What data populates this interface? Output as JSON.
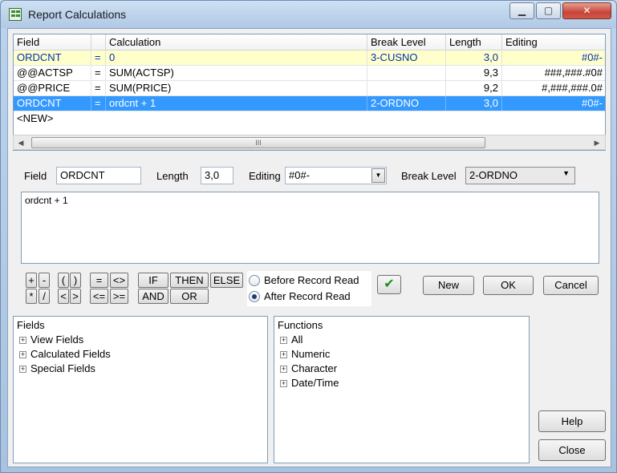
{
  "window": {
    "title": "Report Calculations"
  },
  "grid": {
    "headers": [
      "Field",
      "",
      "Calculation",
      "Break Level",
      "Length",
      "Editing"
    ],
    "rows": [
      [
        "ORDCNT",
        "=",
        "0",
        "3-CUSNO",
        "3,0",
        "#0#-"
      ],
      [
        "@@ACTSP",
        "=",
        "SUM(ACTSP)",
        "",
        "9,3",
        "###,###.#0#"
      ],
      [
        "@@PRICE",
        "=",
        "SUM(PRICE)",
        "",
        "9,2",
        "#,###,###.0#"
      ],
      [
        "ORDCNT",
        "=",
        "ordcnt + 1",
        "2-ORDNO",
        "3,0",
        "#0#-"
      ],
      [
        "<NEW>",
        "",
        "",
        "",
        "",
        ""
      ]
    ],
    "scroll_grip": "III"
  },
  "edit": {
    "field_label": "Field",
    "field_value": "ORDCNT",
    "length_label": "Length",
    "length_value": "3,0",
    "editing_label": "Editing",
    "editing_value": "#0#-",
    "break_label": "Break Level",
    "break_value": "2-ORDNO",
    "calculation_text": "ordcnt + 1"
  },
  "operators": {
    "plus": "+",
    "minus": "-",
    "lparen": "(",
    "rparen": ")",
    "eq": "=",
    "ne": "<>",
    "mul": "*",
    "div": "/",
    "lt": "<",
    "gt": ">",
    "le": "<=",
    "ge": ">=",
    "if": "IF",
    "then": "THEN",
    "else": "ELSE",
    "and": "AND",
    "or": "OR"
  },
  "timing": {
    "before": "Before Record Read",
    "after": "After Record Read",
    "selected": "after"
  },
  "buttons": {
    "check": "✔",
    "new": "New",
    "ok": "OK",
    "cancel": "Cancel",
    "help": "Help",
    "close": "Close"
  },
  "fields_tree": {
    "title": "Fields",
    "items": [
      "View Fields",
      "Calculated Fields",
      "Special Fields"
    ]
  },
  "functions_tree": {
    "title": "Functions",
    "items": [
      "All",
      "Numeric",
      "Character",
      "Date/Time"
    ]
  }
}
